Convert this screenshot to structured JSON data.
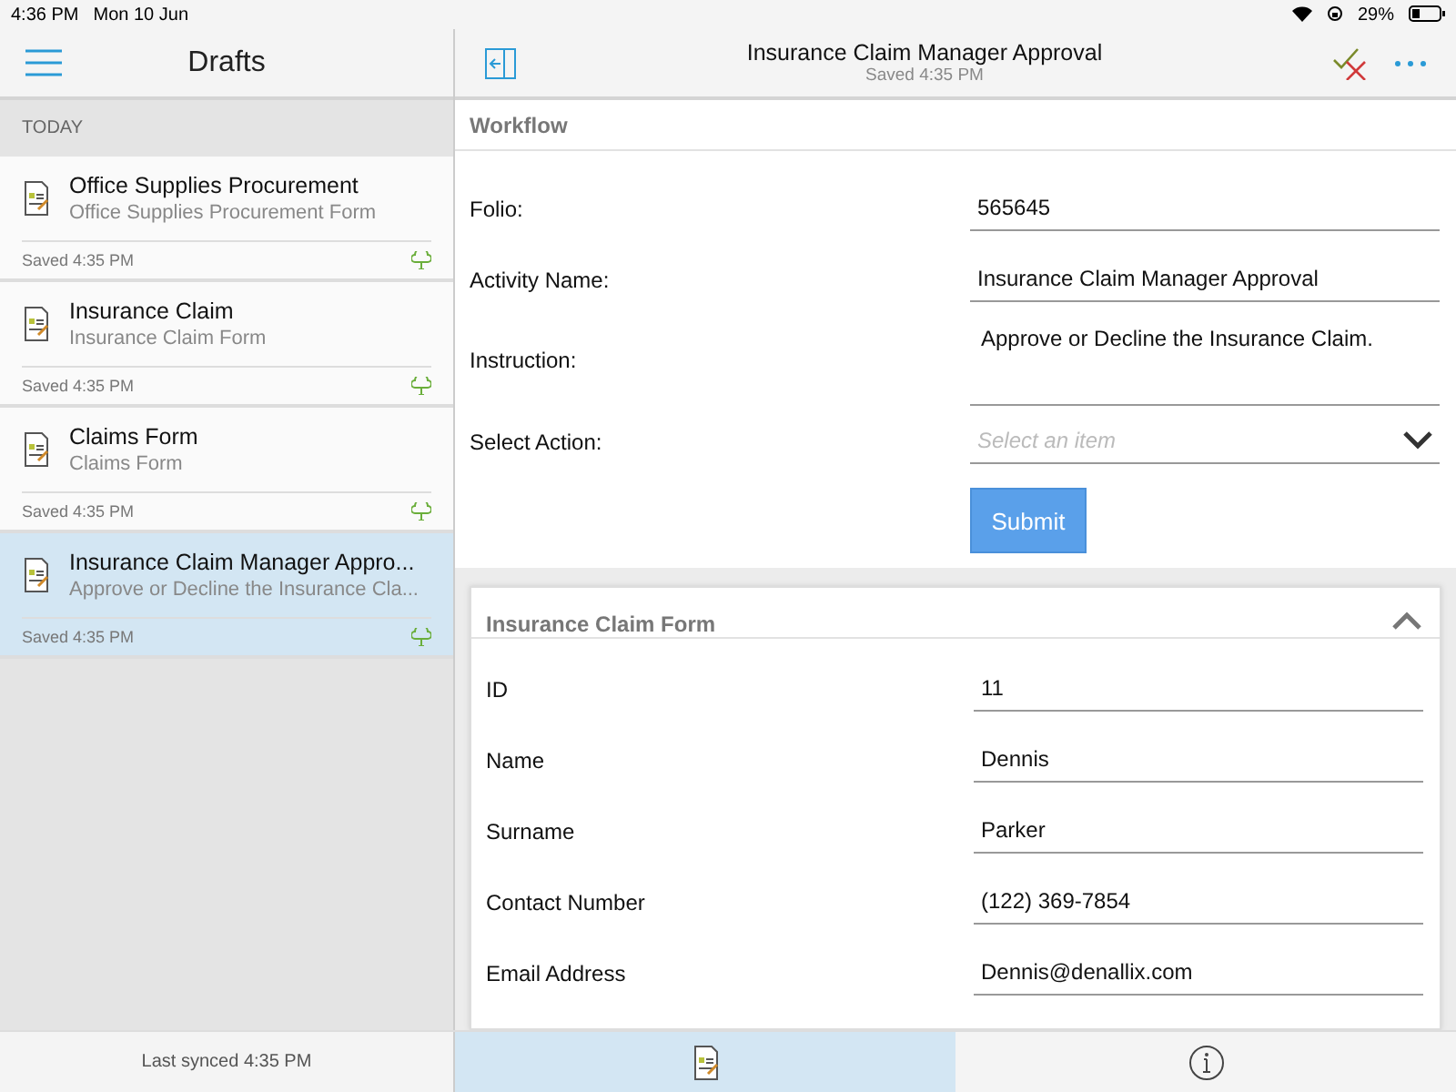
{
  "status_bar": {
    "time": "4:36 PM",
    "date": "Mon 10 Jun",
    "battery": "29%"
  },
  "sidebar": {
    "title": "Drafts",
    "section": "TODAY",
    "items": [
      {
        "title": "Office Supplies Procurement",
        "subtitle": "Office Supplies Procurement Form",
        "saved": "Saved 4:35 PM",
        "selected": false
      },
      {
        "title": "Insurance Claim",
        "subtitle": "Insurance Claim Form",
        "saved": "Saved 4:35 PM",
        "selected": false
      },
      {
        "title": "Claims Form",
        "subtitle": "Claims Form",
        "saved": "Saved 4:35 PM",
        "selected": false
      },
      {
        "title": "Insurance Claim Manager Appro...",
        "subtitle": "Approve or Decline the Insurance Cla...",
        "saved": "Saved 4:35 PM",
        "selected": true
      }
    ],
    "footer": "Last synced 4:35 PM"
  },
  "header": {
    "title": "Insurance Claim Manager Approval",
    "subtitle": "Saved 4:35 PM"
  },
  "workflow": {
    "title": "Workflow",
    "fields": [
      {
        "kind": "text",
        "label": "Folio:",
        "value": "565645"
      },
      {
        "kind": "text",
        "label": "Activity Name:",
        "value": "Insurance Claim Manager Approval"
      },
      {
        "kind": "textarea",
        "label": "Instruction:",
        "value": "Approve or Decline the Insurance Claim."
      },
      {
        "kind": "select",
        "label": "Select Action:",
        "placeholder": "Select an item"
      }
    ],
    "button": "Submit"
  },
  "form": {
    "title": "Insurance Claim Form",
    "expanded": true,
    "fields": [
      {
        "label": "ID",
        "value": "11"
      },
      {
        "label": "Name",
        "value": "Dennis"
      },
      {
        "label": "Surname",
        "value": "Parker"
      },
      {
        "label": "Contact Number",
        "value": "(122) 369-7854"
      },
      {
        "label": "Email Address",
        "value": "Dennis@denallix.com"
      }
    ]
  },
  "tabs": [
    {
      "kind": "document",
      "selected": true
    },
    {
      "kind": "info",
      "selected": false
    }
  ]
}
